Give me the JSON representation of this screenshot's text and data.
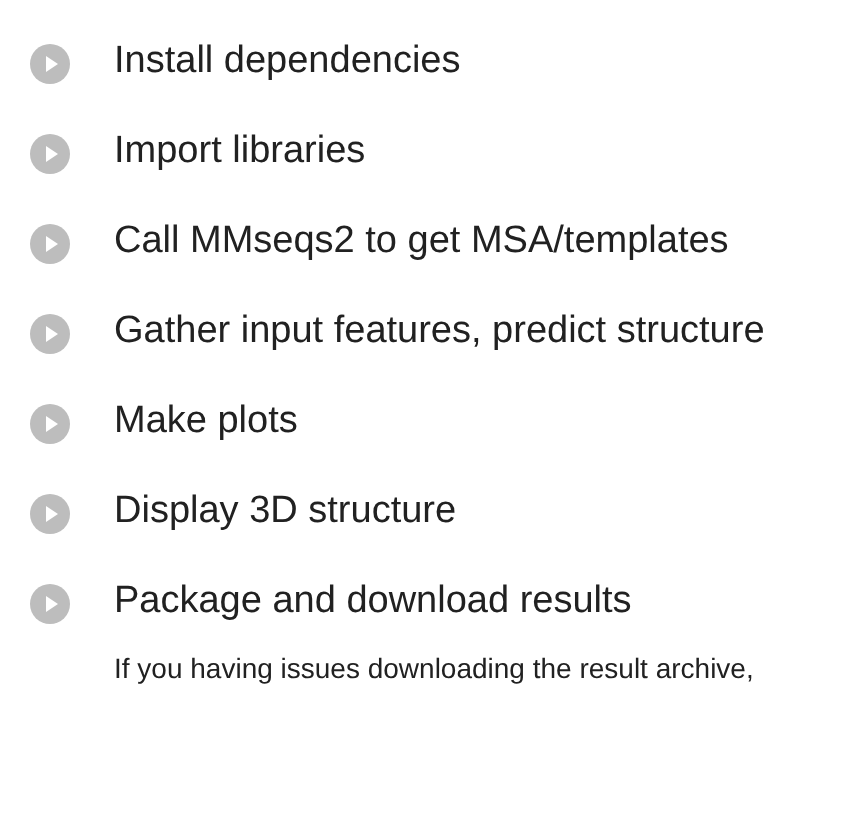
{
  "sections": [
    {
      "title": "Install dependencies"
    },
    {
      "title": "Import libraries"
    },
    {
      "title": "Call MMseqs2 to get MSA/templates"
    },
    {
      "title": "Gather input features, predict structure"
    },
    {
      "title": "Make plots"
    },
    {
      "title": "Display 3D structure"
    },
    {
      "title": "Package and download results",
      "note": "If you having issues downloading the result archive,"
    }
  ]
}
